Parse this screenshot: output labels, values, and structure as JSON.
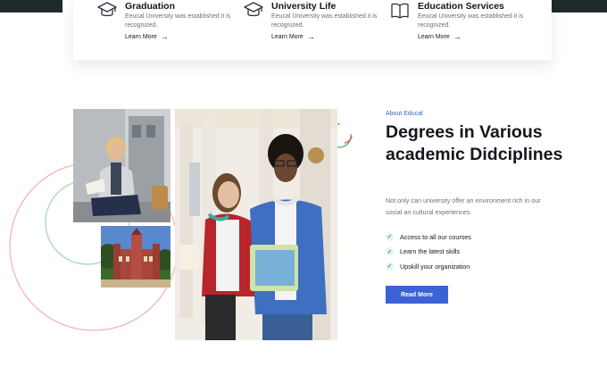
{
  "features": [
    {
      "icon": "graduation-cap-icon",
      "title": "Graduation",
      "description": "Eeucal University was established it is recognized.",
      "link": "Learn More"
    },
    {
      "icon": "graduation-cap-icon",
      "title": "University Life",
      "description": "Eeucal University was established it is recognized.",
      "link": "Learn More"
    },
    {
      "icon": "open-book-icon",
      "title": "Education Services",
      "description": "Eeucal University was established it is recognized.",
      "link": "Learn More"
    }
  ],
  "about": {
    "label": "About Educal",
    "heading": "Degrees in Various academic Didciplines",
    "description": "Not only can university offer an environment rich in our social an cultural experiences.",
    "checklist": [
      "Access to all our courses",
      "Learn the latest skills",
      "Upskill your organization"
    ],
    "cta": "Read More"
  },
  "colors": {
    "accent": "#3b63d6",
    "check": "#2f9e5c",
    "circle_red": "#f3b1ad",
    "circle_green": "#9fd8b0"
  }
}
